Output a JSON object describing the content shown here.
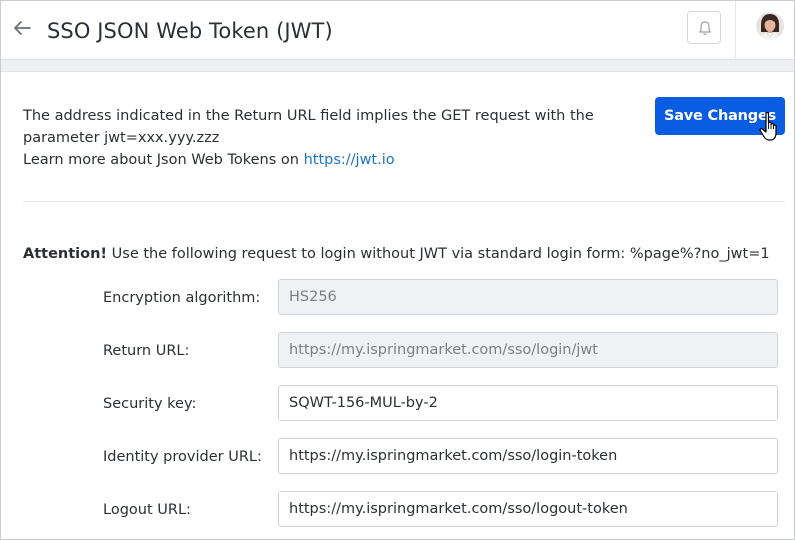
{
  "header": {
    "title": "SSO JSON Web Token (JWT)",
    "back_icon": "arrow-left-icon",
    "notifications_icon": "bell-icon"
  },
  "intro": {
    "line1": "The address indicated in the Return URL field implies the GET request with the",
    "line2": "parameter jwt=xxx.yyy.zzz",
    "line3_prefix": "Learn more about Json Web Tokens on ",
    "link_text": "https://jwt.io"
  },
  "save_button": {
    "label": "Save Changes"
  },
  "attention": {
    "bold": "Attention!",
    "text": " Use the following request to login without JWT via standard login form: %page%?no_jwt=1"
  },
  "form": {
    "fields": [
      {
        "label": "Encryption algorithm:",
        "value": "HS256",
        "disabled": true
      },
      {
        "label": "Return URL:",
        "value": "https://my.ispringmarket.com/sso/login/jwt",
        "disabled": true
      },
      {
        "label": "Security key:",
        "value": "SQWT-156-MUL-by-2",
        "disabled": false
      },
      {
        "label": "Identity provider URL:",
        "value": "https://my.ispringmarket.com/sso/login-token",
        "disabled": false
      },
      {
        "label": "Logout URL:",
        "value": "https://my.ispringmarket.com/sso/logout-token",
        "disabled": false
      }
    ]
  },
  "colors": {
    "accent": "#0a5ce0",
    "link": "#1a73c8",
    "disabled_bg": "#f0f1f3"
  }
}
